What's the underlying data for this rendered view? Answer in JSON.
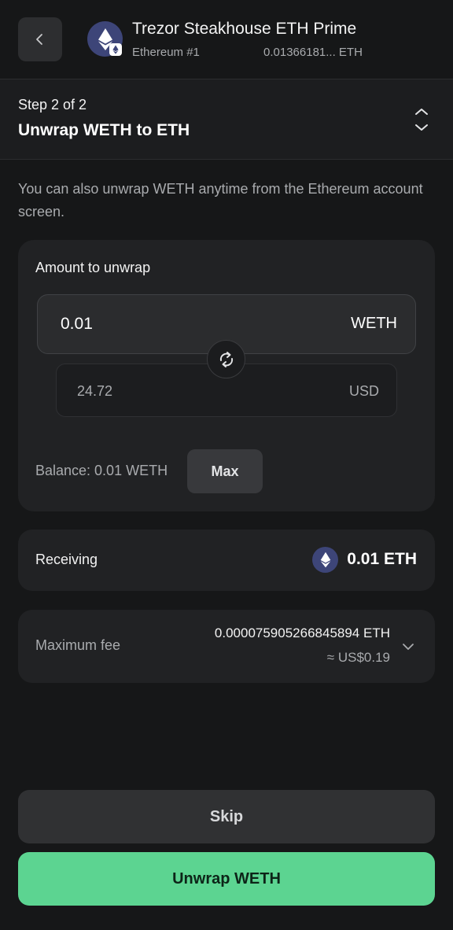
{
  "header": {
    "account_name": "Trezor Steakhouse ETH Prime",
    "network": "Ethereum #1",
    "balance": "0.01366181... ETH"
  },
  "step": {
    "count": "Step 2 of 2",
    "title": "Unwrap WETH to ETH"
  },
  "info_text": "You can also unwrap WETH anytime from the Ethereum account screen.",
  "amount": {
    "label": "Amount to unwrap",
    "value": "0.01",
    "unit": "WETH",
    "fiat_value": "24.72",
    "fiat_unit": "USD",
    "balance": "Balance: 0.01 WETH",
    "max_label": "Max"
  },
  "receiving": {
    "label": "Receiving",
    "amount": "0.01 ETH"
  },
  "fee": {
    "label": "Maximum fee",
    "amount": "0.000075905266845894 ETH",
    "fiat": "≈ US$0.19"
  },
  "buttons": {
    "skip": "Skip",
    "unwrap": "Unwrap WETH"
  },
  "colors": {
    "background": "#161718",
    "card": "#212224",
    "accent": "#5cd491",
    "eth_icon": "#3d4578"
  },
  "icons": {
    "back": "chevron-left-icon",
    "account": "ethereum-icon",
    "step_toggle": "expand-collapse-icon",
    "swap": "swap-rotate-icon",
    "fee_expand": "chevron-down-icon"
  }
}
